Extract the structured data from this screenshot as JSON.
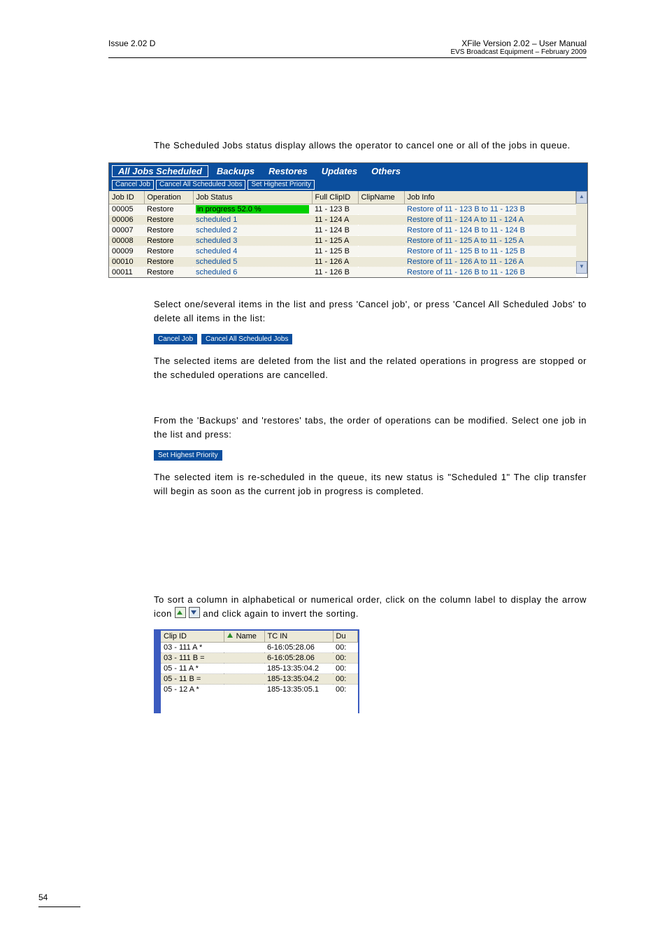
{
  "header": {
    "left": "Issue 2.02 D",
    "right_title": "XFile Version 2.02 – User Manual",
    "right_sub": "EVS Broadcast Equipment – February 2009"
  },
  "para1": "The Scheduled Jobs status display allows the operator to cancel one or all of the jobs in queue.",
  "sched_panel": {
    "tabs": [
      "All Jobs Scheduled",
      "Backups",
      "Restores",
      "Updates",
      "Others"
    ],
    "actions": [
      "Cancel Job",
      "Cancel All Scheduled Jobs",
      "Set Highest Priority"
    ],
    "columns": [
      "Job ID",
      "Operation",
      "Job Status",
      "Full ClipID",
      "ClipName",
      "Job Info"
    ],
    "rows": [
      {
        "id": "00005",
        "op": "Restore",
        "status": "in progress 52.0 %",
        "status_kind": "ip",
        "clip": "11 - 123 B",
        "name": "",
        "info": "Restore of 11 - 123 B to 11 - 123 B"
      },
      {
        "id": "00006",
        "op": "Restore",
        "status": "scheduled 1",
        "status_kind": "blue",
        "clip": "11 - 124 A",
        "name": "",
        "info": "Restore of 11 - 124 A to 11 - 124 A"
      },
      {
        "id": "00007",
        "op": "Restore",
        "status": "scheduled 2",
        "status_kind": "blue",
        "clip": "11 - 124 B",
        "name": "",
        "info": "Restore of 11 - 124 B to 11 - 124 B"
      },
      {
        "id": "00008",
        "op": "Restore",
        "status": "scheduled 3",
        "status_kind": "blue",
        "clip": "11 - 125 A",
        "name": "",
        "info": "Restore of 11 - 125 A to 11 - 125 A"
      },
      {
        "id": "00009",
        "op": "Restore",
        "status": "scheduled 4",
        "status_kind": "blue",
        "clip": "11 - 125 B",
        "name": "",
        "info": "Restore of 11 - 125 B to 11 - 125 B"
      },
      {
        "id": "00010",
        "op": "Restore",
        "status": "scheduled 5",
        "status_kind": "blue",
        "clip": "11 - 126 A",
        "name": "",
        "info": "Restore of 11 - 126 A to 11 - 126 A"
      },
      {
        "id": "00011",
        "op": "Restore",
        "status": "scheduled 6",
        "status_kind": "blue",
        "clip": "11 - 126 B",
        "name": "",
        "info": "Restore of 11 - 126 B to 11 - 126 B"
      }
    ]
  },
  "para2": "Select one/several items in the list and press 'Cancel job', or press 'Cancel All Scheduled Jobs' to delete all items in the list:",
  "chips1": [
    "Cancel Job",
    "Cancel All Scheduled Jobs"
  ],
  "para3": "The selected items are deleted from the list and the related operations in progress are stopped or the scheduled operations are cancelled.",
  "para4": "From the 'Backups' and 'restores' tabs, the order of operations can be modified. Select one job in the list and press:",
  "chips2": [
    "Set Highest Priority"
  ],
  "para5": "The selected item is re-scheduled in the queue, its new status is \"Scheduled 1\" The clip transfer will begin as soon as the current job in progress is completed.",
  "para6a": "To sort a column in alphabetical or numerical order, click on the column label to display the arrow icon ",
  "para6b": " and click again to invert the sorting.",
  "clip_table": {
    "columns": [
      "Clip ID",
      "Name",
      "TC IN",
      "Du"
    ],
    "sort_col": 1,
    "rows": [
      {
        "clip": "03 - 111 A *",
        "name": "",
        "tc": "6-16:05:28.06",
        "du": "00:"
      },
      {
        "clip": "03 - 111 B =",
        "name": "",
        "tc": "6-16:05:28.06",
        "du": "00:"
      },
      {
        "clip": "05 - 11 A *",
        "name": "",
        "tc": "185-13:35:04.2",
        "du": "00:"
      },
      {
        "clip": "05 - 11 B =",
        "name": "",
        "tc": "185-13:35:04.2",
        "du": "00:"
      },
      {
        "clip": "05 - 12 A *",
        "name": "",
        "tc": "185-13:35:05.1",
        "du": "00:"
      }
    ]
  },
  "page_number": "54"
}
